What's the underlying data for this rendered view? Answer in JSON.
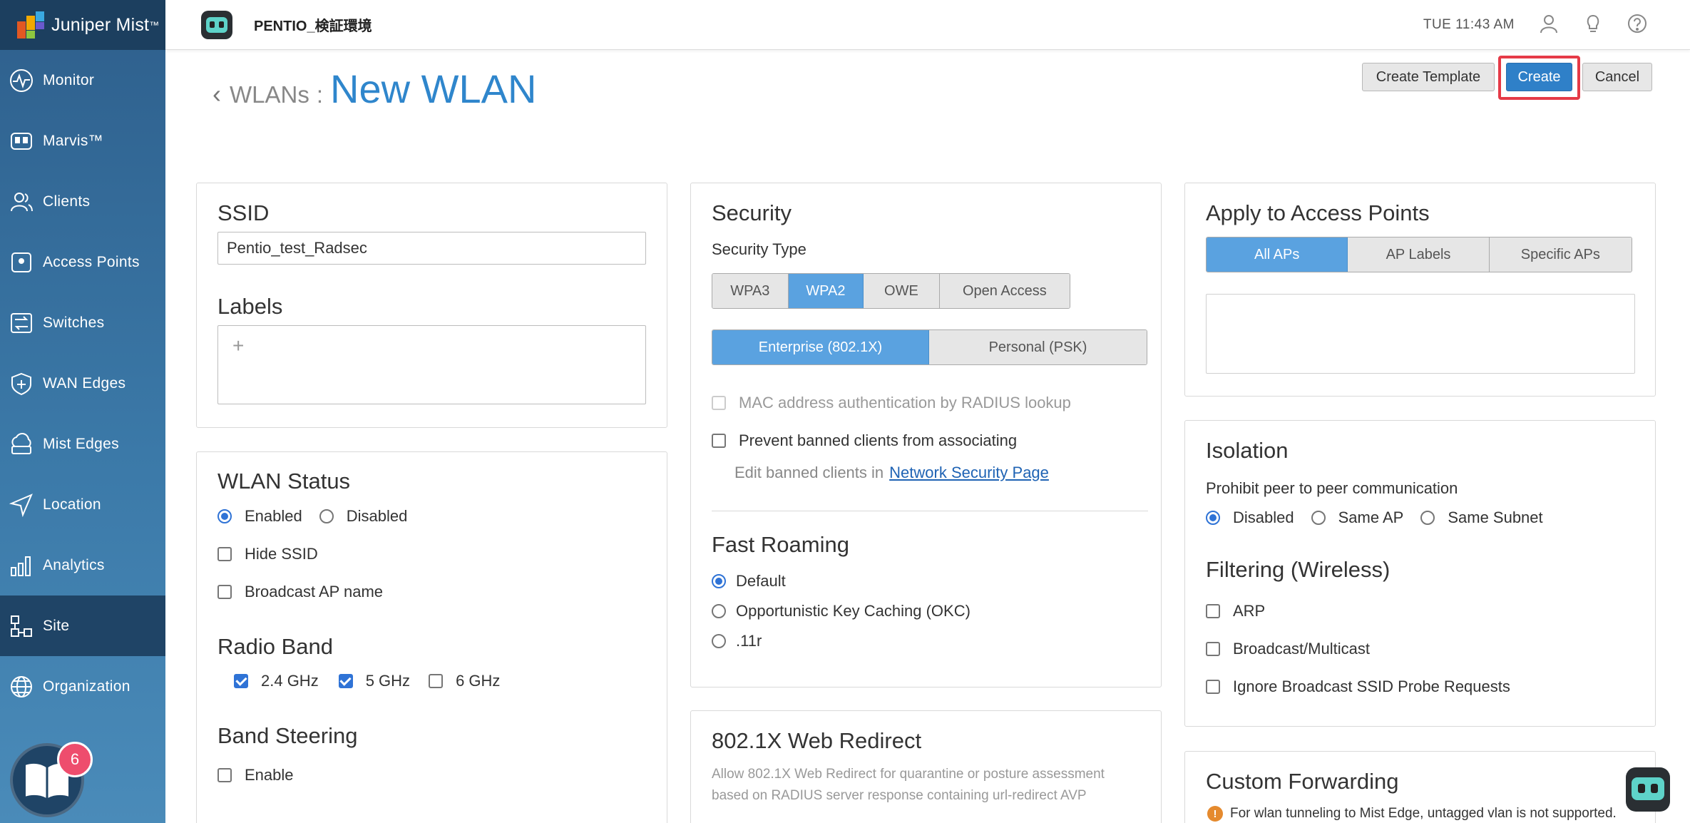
{
  "app": {
    "brand": "Juniper Mist",
    "brand_tm": "™",
    "site_name": "PENTIO_検証環境",
    "clock": "TUE 11:43 AM"
  },
  "sidebar": {
    "items": [
      {
        "label": "Monitor",
        "icon": "monitor-pulse-icon"
      },
      {
        "label": "Marvis™",
        "icon": "marvis-icon"
      },
      {
        "label": "Clients",
        "icon": "clients-icon"
      },
      {
        "label": "Access Points",
        "icon": "access-point-icon"
      },
      {
        "label": "Switches",
        "icon": "switch-icon"
      },
      {
        "label": "WAN Edges",
        "icon": "wan-edge-icon"
      },
      {
        "label": "Mist Edges",
        "icon": "mist-edge-icon"
      },
      {
        "label": "Location",
        "icon": "location-icon"
      },
      {
        "label": "Analytics",
        "icon": "analytics-icon"
      },
      {
        "label": "Site",
        "icon": "site-icon"
      },
      {
        "label": "Organization",
        "icon": "organization-icon"
      }
    ],
    "active": "Site",
    "help_badge": "6"
  },
  "header": {
    "parent": "WLANs",
    "separator": ":",
    "title": "New WLAN",
    "create_template": "Create Template",
    "create": "Create",
    "cancel": "Cancel"
  },
  "ssid": {
    "title": "SSID",
    "value": "Pentio_test_Radsec",
    "labels_title": "Labels",
    "add_symbol": "+"
  },
  "wlan_status": {
    "title": "WLAN Status",
    "enabled": "Enabled",
    "disabled": "Disabled",
    "hide_ssid": "Hide SSID",
    "broadcast_ap": "Broadcast AP name",
    "radio_title": "Radio Band",
    "band_24": "2.4 GHz",
    "band_5": "5 GHz",
    "band_6": "6 GHz",
    "steering_title": "Band Steering",
    "steering_enable": "Enable"
  },
  "security": {
    "title": "Security",
    "type_label": "Security Type",
    "types": [
      "WPA3",
      "WPA2",
      "OWE",
      "Open Access"
    ],
    "selected_type": "WPA2",
    "modes": [
      "Enterprise (802.1X)",
      "Personal (PSK)"
    ],
    "selected_mode": "Enterprise (802.1X)",
    "mac_auth": "MAC address authentication by RADIUS lookup",
    "prevent_banned": "Prevent banned clients from associating",
    "edit_banned": "Edit banned clients in",
    "network_security_link": "Network Security Page",
    "fast_roaming_title": "Fast Roaming",
    "roaming_default": "Default",
    "roaming_okc": "Opportunistic Key Caching (OKC)",
    "roaming_11r": ".11r"
  },
  "web_redirect": {
    "title": "802.1X Web Redirect",
    "description_1": "Allow 802.1X Web Redirect for quarantine or posture assessment",
    "description_2": "based on RADIUS server response containing url-redirect AVP"
  },
  "apply_aps": {
    "title": "Apply to Access Points",
    "options": [
      "All APs",
      "AP Labels",
      "Specific APs"
    ],
    "selected": "All APs"
  },
  "isolation": {
    "title": "Isolation",
    "prohibit": "Prohibit peer to peer communication",
    "disabled": "Disabled",
    "same_ap": "Same AP",
    "same_subnet": "Same Subnet",
    "filtering_title": "Filtering (Wireless)",
    "arp": "ARP",
    "broadcast": "Broadcast/Multicast",
    "ignore_probe": "Ignore Broadcast SSID Probe Requests"
  },
  "custom_forwarding": {
    "title": "Custom Forwarding",
    "warning": "For wlan tunneling to Mist Edge, untagged vlan is not supported."
  },
  "colors": {
    "accent": "#2f86cc",
    "sidebar_top": "#2e5f8c",
    "highlight": "#e53a47",
    "segment_on": "#5aa2e0"
  }
}
